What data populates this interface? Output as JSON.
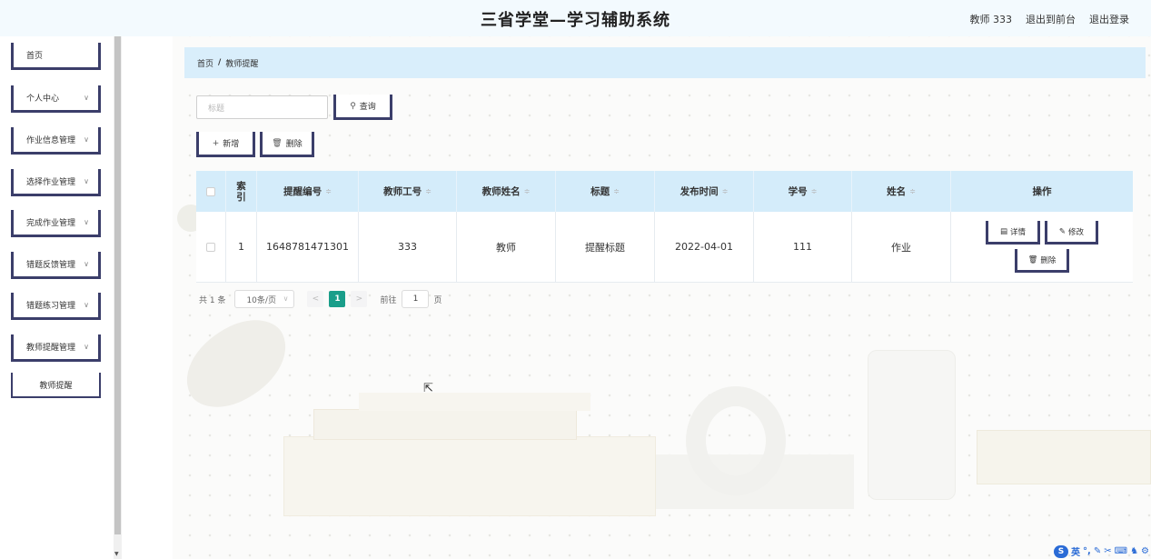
{
  "header": {
    "title": "三省学堂—学习辅助系统",
    "user": "教师 333",
    "to_front": "退出到前台",
    "logout": "退出登录"
  },
  "sidebar": {
    "items": [
      {
        "label": "首页",
        "has_arrow": false
      },
      {
        "label": "个人中心",
        "has_arrow": true
      },
      {
        "label": "作业信息管理",
        "has_arrow": true
      },
      {
        "label": "选择作业管理",
        "has_arrow": true
      },
      {
        "label": "完成作业管理",
        "has_arrow": true
      },
      {
        "label": "错题反馈管理",
        "has_arrow": true
      },
      {
        "label": "错题练习管理",
        "has_arrow": true
      },
      {
        "label": "教师提醒管理",
        "has_arrow": true
      }
    ],
    "subitem": "教师提醒"
  },
  "breadcrumb": {
    "home": "首页",
    "sep": "/",
    "current": "教师提醒"
  },
  "search": {
    "placeholder": "标题",
    "button": "查询"
  },
  "actions": {
    "add": "新增",
    "delete": "删除"
  },
  "table": {
    "headers": {
      "index": "索引",
      "remind_no": "提醒编号",
      "teacher_no": "教师工号",
      "teacher_name": "教师姓名",
      "title": "标题",
      "publish_time": "发布时间",
      "student_no": "学号",
      "name": "姓名",
      "ops": "操作"
    },
    "rows": [
      {
        "index": "1",
        "remind_no": "1648781471301",
        "teacher_no": "333",
        "teacher_name": "教师",
        "title": "提醒标题",
        "publish_time": "2022-04-01",
        "student_no": "111",
        "name": "作业",
        "ops": {
          "detail": "详情",
          "edit": "修改",
          "delete": "删除"
        }
      }
    ]
  },
  "pager": {
    "total": "共 1 条",
    "page_size": "10条/页",
    "current_page": "1",
    "goto_label": "前往",
    "goto_value": "1",
    "page_unit": "页"
  },
  "ime": {
    "mode": "英"
  },
  "colors": {
    "accent": "#3b3e6a",
    "pager_active": "#1a9e8a",
    "header_bg": "#d4ecfa"
  }
}
